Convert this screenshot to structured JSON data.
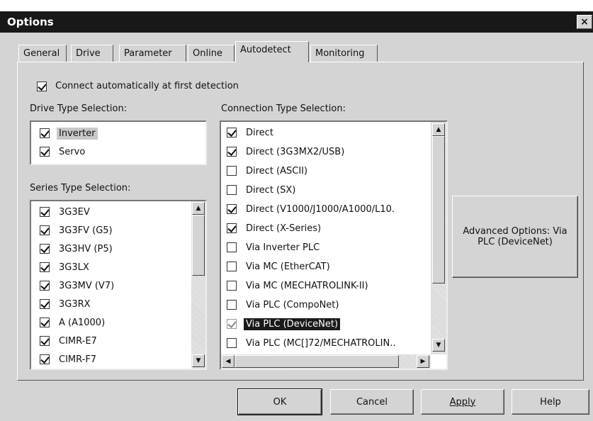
{
  "window": {
    "title": "Options",
    "close_label": "×"
  },
  "tabs": [
    {
      "label": "General"
    },
    {
      "label": "Drive"
    },
    {
      "label": "Parameter"
    },
    {
      "label": "Online"
    },
    {
      "label": "Autodetect"
    },
    {
      "label": "Monitoring"
    }
  ],
  "active_tab": "Autodetect",
  "connect_auto": {
    "label": "Connect automatically at first detection",
    "checked": true
  },
  "drive_type": {
    "heading": "Drive Type Selection:",
    "items": [
      {
        "label": "Inverter",
        "checked": true
      },
      {
        "label": "Servo",
        "checked": true
      }
    ]
  },
  "series_type": {
    "heading": "Series Type Selection:",
    "items": [
      {
        "label": "3G3EV",
        "checked": true
      },
      {
        "label": "3G3FV (G5)",
        "checked": true
      },
      {
        "label": "3G3HV (P5)",
        "checked": true
      },
      {
        "label": "3G3LX",
        "checked": true
      },
      {
        "label": "3G3MV (V7)",
        "checked": true
      },
      {
        "label": "3G3RX",
        "checked": true
      },
      {
        "label": "A (A1000)",
        "checked": true
      },
      {
        "label": "CIMR-E7",
        "checked": true
      },
      {
        "label": "CIMR-F7",
        "checked": true
      }
    ]
  },
  "connection_type": {
    "heading": "Connection Type Selection:",
    "items": [
      {
        "label": "Direct",
        "checked": true
      },
      {
        "label": "Direct (3G3MX2/USB)",
        "checked": true
      },
      {
        "label": "Direct (ASCII)",
        "checked": false
      },
      {
        "label": "Direct (SX)",
        "checked": false
      },
      {
        "label": "Direct (V1000/J1000/A1000/L10.",
        "checked": true
      },
      {
        "label": "Direct (X-Series)",
        "checked": true
      },
      {
        "label": "Via Inverter PLC",
        "checked": false
      },
      {
        "label": "Via MC (EtherCAT)",
        "checked": false
      },
      {
        "label": "Via MC (MECHATROLINK-II)",
        "checked": false
      },
      {
        "label": "Via PLC (CompoNet)",
        "checked": false
      },
      {
        "label": "Via PLC (DeviceNet)",
        "checked": true
      },
      {
        "label": "Via PLC (MC[]72/MECHATROLIN..",
        "checked": false
      }
    ]
  },
  "advanced_button": {
    "label": "Advanced Options: Via PLC (DeviceNet)"
  },
  "buttons": {
    "ok": "OK",
    "cancel": "Cancel",
    "apply": "Apply",
    "help": "Help"
  },
  "icons": {
    "close": "close-icon",
    "scroll_up": "scroll-up-arrow-icon",
    "scroll_down": "scroll-down-arrow-icon",
    "scroll_left": "scroll-left-arrow-icon",
    "scroll_right": "scroll-right-arrow-icon"
  }
}
